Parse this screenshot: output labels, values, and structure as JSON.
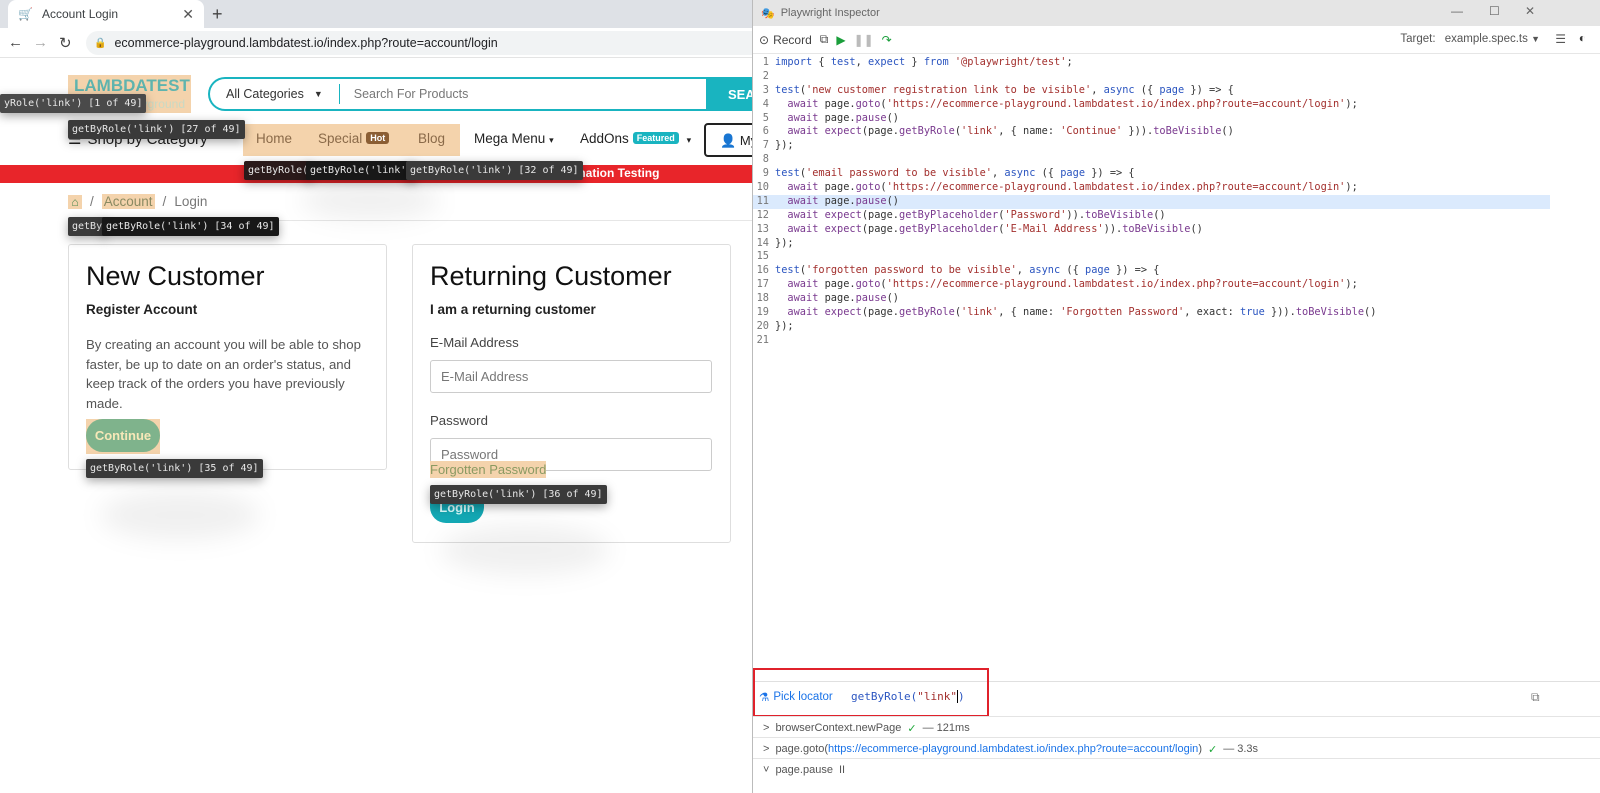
{
  "browser": {
    "tab_title": "Account Login",
    "tab_favicon": "cart-icon",
    "new_tab_label": "+",
    "url": "ecommerce-playground.lambdatest.io/index.php?route=account/login"
  },
  "site": {
    "logo_main": "LAMBDATEST",
    "logo_sub": "Playground",
    "search": {
      "category_selected": "All Categories",
      "placeholder": "Search For Products",
      "button_label": "SEA"
    },
    "shop_by_category": "Shop by Category",
    "nav": [
      {
        "label": "Home"
      },
      {
        "label": "Special",
        "badge": "Hot",
        "badge_color": "#8b5e34"
      },
      {
        "label": "Blog"
      },
      {
        "label": "Mega Menu"
      },
      {
        "label": "AddOns",
        "badge": "Featured",
        "badge_color": "#19b4c0"
      }
    ],
    "my_account_label": "My",
    "promo_text": "mation Testing",
    "breadcrumb": {
      "account": "Account",
      "login": "Login",
      "sep": "/"
    },
    "new_customer": {
      "title": "New Customer",
      "subtitle": "Register Account",
      "body": "By creating an account you will be able to shop faster, be up to date on an order's status, and keep track of the orders you have previously made.",
      "button": "Continue"
    },
    "returning_customer": {
      "title": "Returning Customer",
      "subtitle": "I am a returning customer",
      "email_label": "E-Mail Address",
      "email_placeholder": "E-Mail Address",
      "password_label": "Password",
      "password_placeholder": "Password",
      "forgotten_link": "Forgotten Password",
      "login_button": "Login"
    },
    "locator_tooltips": {
      "t1": "yRole('link') [1 of 49]",
      "t27": "getByRole('link') [27 of 49]",
      "t_a": "getByRole(",
      "t_b": "getByRole('link')",
      "t32": "getByRole('link') [32 of 49]",
      "t_c": "getBy",
      "t34": "getByRole('link') [34 of 49]",
      "t35": "getByRole('link') [35 of 49]",
      "t36": "getByRole('link') [36 of 49]"
    }
  },
  "inspector": {
    "title": "Playwright Inspector",
    "toolbar": {
      "record_label": "Record",
      "target_label": "Target:",
      "target_value": "example.spec.ts"
    },
    "current_line": 11,
    "code_lines": [
      [
        [
          "kw",
          "import"
        ],
        [
          "pl",
          " { "
        ],
        [
          "kw",
          "test"
        ],
        [
          "pl",
          ", "
        ],
        [
          "kw",
          "expect"
        ],
        [
          "pl",
          " } "
        ],
        [
          "kw",
          "from"
        ],
        [
          "pl",
          " "
        ],
        [
          "str",
          "'@playwright/test'"
        ],
        [
          "pl",
          ";"
        ]
      ],
      [],
      [
        [
          "kw",
          "test"
        ],
        [
          "pl",
          "("
        ],
        [
          "str",
          "'new customer registration link to be visible'"
        ],
        [
          "pl",
          ", "
        ],
        [
          "kw",
          "async"
        ],
        [
          "pl",
          " ({ "
        ],
        [
          "kw",
          "page"
        ],
        [
          "pl",
          " }) => {"
        ]
      ],
      [
        [
          "pl",
          "  "
        ],
        [
          "fn",
          "await"
        ],
        [
          "pl",
          " page."
        ],
        [
          "fn",
          "goto"
        ],
        [
          "pl",
          "("
        ],
        [
          "str",
          "'https://ecommerce-playground.lambdatest.io/index.php?route=account/login'"
        ],
        [
          "pl",
          ");"
        ]
      ],
      [
        [
          "pl",
          "  "
        ],
        [
          "fn",
          "await"
        ],
        [
          "pl",
          " page."
        ],
        [
          "fn",
          "pause"
        ],
        [
          "pl",
          "()"
        ]
      ],
      [
        [
          "pl",
          "  "
        ],
        [
          "fn",
          "await"
        ],
        [
          "pl",
          " "
        ],
        [
          "fn",
          "expect"
        ],
        [
          "pl",
          "(page."
        ],
        [
          "fn",
          "getByRole"
        ],
        [
          "pl",
          "("
        ],
        [
          "str",
          "'link'"
        ],
        [
          "pl",
          ", { name: "
        ],
        [
          "str",
          "'Continue'"
        ],
        [
          "pl",
          " }))."
        ],
        [
          "fn",
          "toBeVisible"
        ],
        [
          "pl",
          "()"
        ]
      ],
      [
        [
          "pl",
          "});"
        ]
      ],
      [],
      [
        [
          "kw",
          "test"
        ],
        [
          "pl",
          "("
        ],
        [
          "str",
          "'email password to be visible'"
        ],
        [
          "pl",
          ", "
        ],
        [
          "kw",
          "async"
        ],
        [
          "pl",
          " ({ "
        ],
        [
          "kw",
          "page"
        ],
        [
          "pl",
          " }) => {"
        ]
      ],
      [
        [
          "pl",
          "  "
        ],
        [
          "fn",
          "await"
        ],
        [
          "pl",
          " page."
        ],
        [
          "fn",
          "goto"
        ],
        [
          "pl",
          "("
        ],
        [
          "str",
          "'https://ecommerce-playground.lambdatest.io/index.php?route=account/login'"
        ],
        [
          "pl",
          ");"
        ]
      ],
      [
        [
          "pl",
          "  "
        ],
        [
          "fn",
          "await"
        ],
        [
          "pl",
          " page."
        ],
        [
          "fn",
          "pause"
        ],
        [
          "pl",
          "()"
        ]
      ],
      [
        [
          "pl",
          "  "
        ],
        [
          "fn",
          "await"
        ],
        [
          "pl",
          " "
        ],
        [
          "fn",
          "expect"
        ],
        [
          "pl",
          "(page."
        ],
        [
          "fn",
          "getByPlaceholder"
        ],
        [
          "pl",
          "("
        ],
        [
          "str",
          "'Password'"
        ],
        [
          "pl",
          "))."
        ],
        [
          "fn",
          "toBeVisible"
        ],
        [
          "pl",
          "()"
        ]
      ],
      [
        [
          "pl",
          "  "
        ],
        [
          "fn",
          "await"
        ],
        [
          "pl",
          " "
        ],
        [
          "fn",
          "expect"
        ],
        [
          "pl",
          "(page."
        ],
        [
          "fn",
          "getByPlaceholder"
        ],
        [
          "pl",
          "("
        ],
        [
          "str",
          "'E-Mail Address'"
        ],
        [
          "pl",
          "))."
        ],
        [
          "fn",
          "toBeVisible"
        ],
        [
          "pl",
          "()"
        ]
      ],
      [
        [
          "pl",
          "});"
        ]
      ],
      [],
      [
        [
          "kw",
          "test"
        ],
        [
          "pl",
          "("
        ],
        [
          "str",
          "'forgotten password to be visible'"
        ],
        [
          "pl",
          ", "
        ],
        [
          "kw",
          "async"
        ],
        [
          "pl",
          " ({ "
        ],
        [
          "kw",
          "page"
        ],
        [
          "pl",
          " }) => {"
        ]
      ],
      [
        [
          "pl",
          "  "
        ],
        [
          "fn",
          "await"
        ],
        [
          "pl",
          " page."
        ],
        [
          "fn",
          "goto"
        ],
        [
          "pl",
          "("
        ],
        [
          "str",
          "'https://ecommerce-playground.lambdatest.io/index.php?route=account/login'"
        ],
        [
          "pl",
          ");"
        ]
      ],
      [
        [
          "pl",
          "  "
        ],
        [
          "fn",
          "await"
        ],
        [
          "pl",
          " page."
        ],
        [
          "fn",
          "pause"
        ],
        [
          "pl",
          "()"
        ]
      ],
      [
        [
          "pl",
          "  "
        ],
        [
          "fn",
          "await"
        ],
        [
          "pl",
          " "
        ],
        [
          "fn",
          "expect"
        ],
        [
          "pl",
          "(page."
        ],
        [
          "fn",
          "getByRole"
        ],
        [
          "pl",
          "("
        ],
        [
          "str",
          "'link'"
        ],
        [
          "pl",
          ", { name: "
        ],
        [
          "str",
          "'Forgotten Password'"
        ],
        [
          "pl",
          ", exact: "
        ],
        [
          "kw",
          "true"
        ],
        [
          "pl",
          " }))."
        ],
        [
          "fn",
          "toBeVisible"
        ],
        [
          "pl",
          "()"
        ]
      ],
      [
        [
          "pl",
          "});"
        ]
      ],
      []
    ],
    "pick_locator_label": "Pick locator",
    "locator_fn": "getByRole(",
    "locator_arg": "\"link\"",
    "locator_close": ")",
    "log": [
      {
        "expand": ">",
        "action": "browserContext.newPage",
        "status": "✓",
        "duration": "— 121ms"
      },
      {
        "expand": ">",
        "action": "page.goto(",
        "link": "https://ecommerce-playground.lambdatest.io/index.php?route=account/login",
        "action_end": ")",
        "status": "✓",
        "duration": "— 3.3s"
      },
      {
        "expand": "˅",
        "action": "page.pause",
        "status": "II"
      }
    ]
  }
}
